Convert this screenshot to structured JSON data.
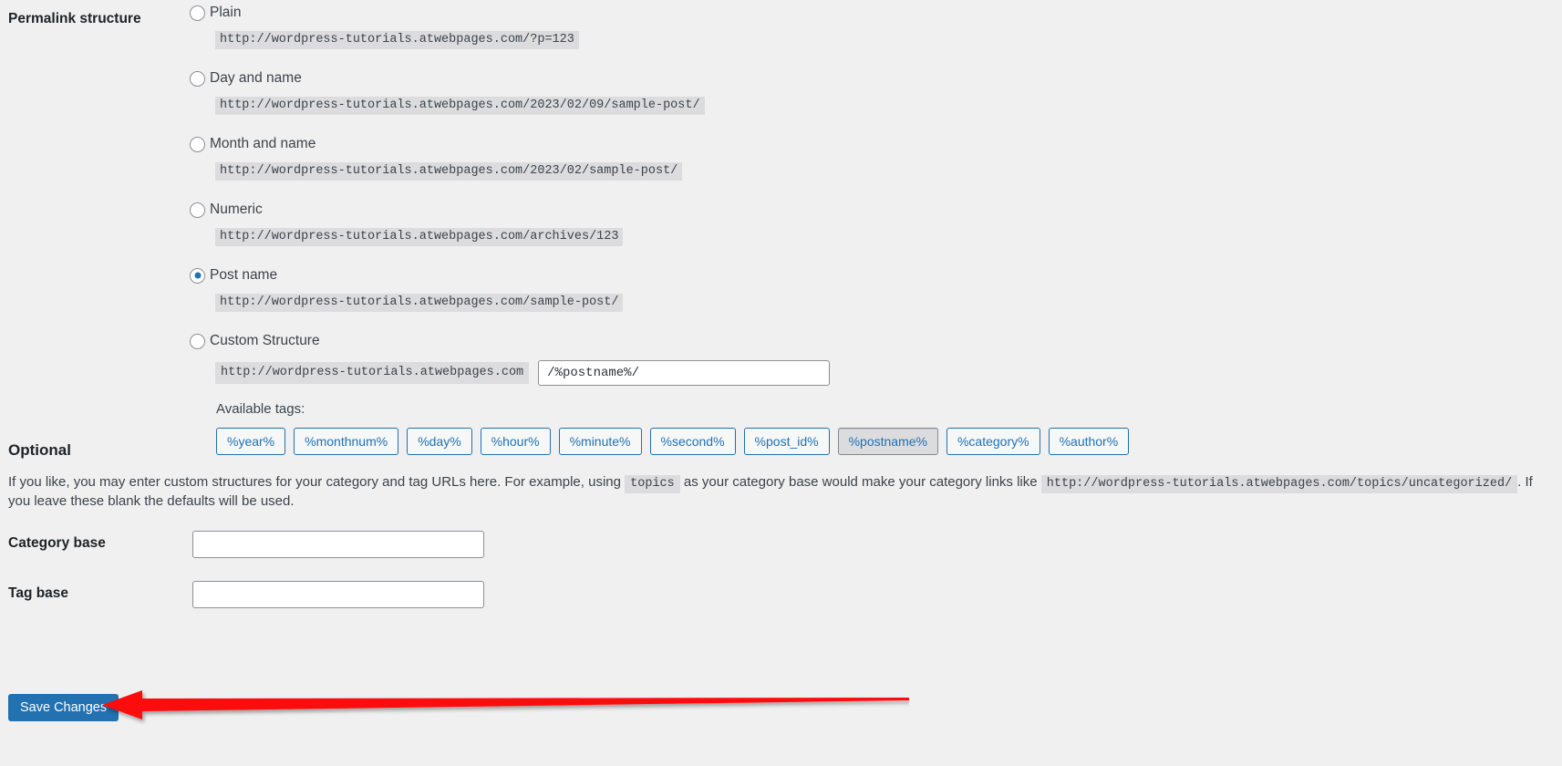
{
  "section": {
    "permalink_label": "Permalink structure",
    "options": [
      {
        "label": "Plain",
        "url": "http://wordpress-tutorials.atwebpages.com/?p=123",
        "selected": false
      },
      {
        "label": "Day and name",
        "url": "http://wordpress-tutorials.atwebpages.com/2023/02/09/sample-post/",
        "selected": false
      },
      {
        "label": "Month and name",
        "url": "http://wordpress-tutorials.atwebpages.com/2023/02/sample-post/",
        "selected": false
      },
      {
        "label": "Numeric",
        "url": "http://wordpress-tutorials.atwebpages.com/archives/123",
        "selected": false
      },
      {
        "label": "Post name",
        "url": "http://wordpress-tutorials.atwebpages.com/sample-post/",
        "selected": true
      },
      {
        "label": "Custom Structure",
        "url": "",
        "selected": false
      }
    ],
    "custom_structure": {
      "prefix": "http://wordpress-tutorials.atwebpages.com",
      "value": "/%postname%/",
      "placeholder": ""
    },
    "available_tags_label": "Available tags:",
    "tags": [
      {
        "label": "%year%",
        "active": false
      },
      {
        "label": "%monthnum%",
        "active": false
      },
      {
        "label": "%day%",
        "active": false
      },
      {
        "label": "%hour%",
        "active": false
      },
      {
        "label": "%minute%",
        "active": false
      },
      {
        "label": "%second%",
        "active": false
      },
      {
        "label": "%post_id%",
        "active": false
      },
      {
        "label": "%postname%",
        "active": true
      },
      {
        "label": "%category%",
        "active": false
      },
      {
        "label": "%author%",
        "active": false
      }
    ]
  },
  "optional": {
    "heading": "Optional",
    "desc_part1": "If you like, you may enter custom structures for your category and tag URLs here. For example, using",
    "desc_code1": "topics",
    "desc_part2": "as your category base would make your category links like",
    "desc_code2": "http://wordpress-tutorials.atwebpages.com/topics/uncategorized/",
    "desc_part3": ". If you leave these blank the defaults will be used.",
    "category_base": {
      "label": "Category base",
      "value": "",
      "placeholder": ""
    },
    "tag_base": {
      "label": "Tag base",
      "value": "",
      "placeholder": ""
    }
  },
  "actions": {
    "save_label": "Save Changes"
  },
  "annotation": {
    "arrow_color": "#fc0d0d",
    "arrow_direction": "left"
  },
  "colors": {
    "background": "#f0f0f1",
    "accent": "#2271b1",
    "code_background": "#dcdcde",
    "text": "#3c434a",
    "heading": "#1d2327"
  }
}
